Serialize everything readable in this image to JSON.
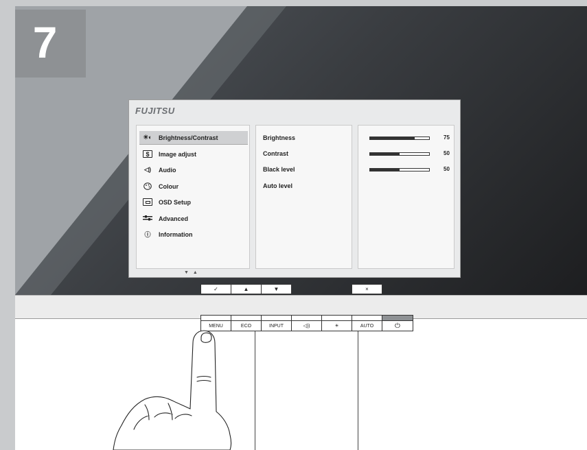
{
  "step": {
    "number": "7"
  },
  "osd": {
    "logo": "FUJITSU",
    "menu_items": [
      {
        "label": "Brightness/Contrast",
        "icon": "brightness-contrast-icon",
        "selected": true
      },
      {
        "label": "Image adjust",
        "icon": "image-adjust-icon",
        "selected": false
      },
      {
        "label": "Audio",
        "icon": "audio-icon",
        "selected": false
      },
      {
        "label": "Colour",
        "icon": "colour-icon",
        "selected": false
      },
      {
        "label": "OSD Setup",
        "icon": "osd-setup-icon",
        "selected": false
      },
      {
        "label": "Advanced",
        "icon": "advanced-icon",
        "selected": false
      },
      {
        "label": "Information",
        "icon": "information-icon",
        "selected": false
      }
    ],
    "sub_items": [
      {
        "label": "Brightness",
        "value": "75",
        "level": 0.75
      },
      {
        "label": "Contrast",
        "value": "50",
        "level": 0.5
      },
      {
        "label": "Black level",
        "value": "50",
        "level": 0.5
      },
      {
        "label": "Auto level",
        "value": null,
        "level": null
      }
    ]
  },
  "osd_keys": [
    {
      "name": "confirm-key",
      "glyph": "✓"
    },
    {
      "name": "up-key",
      "glyph": "▲"
    },
    {
      "name": "down-key",
      "glyph": "▼"
    },
    {
      "name": "close-key",
      "glyph": "×"
    }
  ],
  "bezel_buttons": [
    {
      "name": "menu-button",
      "label": "MENU"
    },
    {
      "name": "eco-button",
      "label": "ECO"
    },
    {
      "name": "input-button",
      "label": "INPUT"
    },
    {
      "name": "volume-button",
      "label": "◁))"
    },
    {
      "name": "brightness-button",
      "label": "☀"
    },
    {
      "name": "auto-button",
      "label": "AUTO"
    },
    {
      "name": "power-button",
      "label": "⏻"
    }
  ]
}
